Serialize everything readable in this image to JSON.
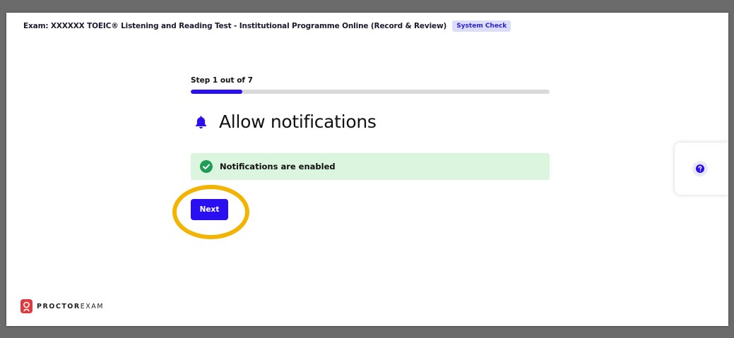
{
  "header": {
    "exam_title": "Exam: XXXXXX TOEIC® Listening and Reading Test - Institutional Programme Online (Record & Review)",
    "badge": "System Check"
  },
  "step": {
    "label": "Step 1 out of 7",
    "current": 1,
    "total": 7,
    "progress_fraction": 0.143
  },
  "main": {
    "heading": "Allow notifications",
    "heading_icon": "bell-icon",
    "status_text": "Notifications are enabled",
    "status_icon": "check-circle-icon",
    "next_label": "Next"
  },
  "help": {
    "icon": "question-icon"
  },
  "brand": {
    "name_strong": "PROCTOR",
    "name_light": "EXAM"
  },
  "colors": {
    "accent": "#2a10f0",
    "success_bg": "#dcf5df",
    "success_icon": "#1f9d55",
    "highlight": "#f2b400",
    "badge_bg": "#dcdcfb",
    "brand_red": "#e03a3e"
  }
}
